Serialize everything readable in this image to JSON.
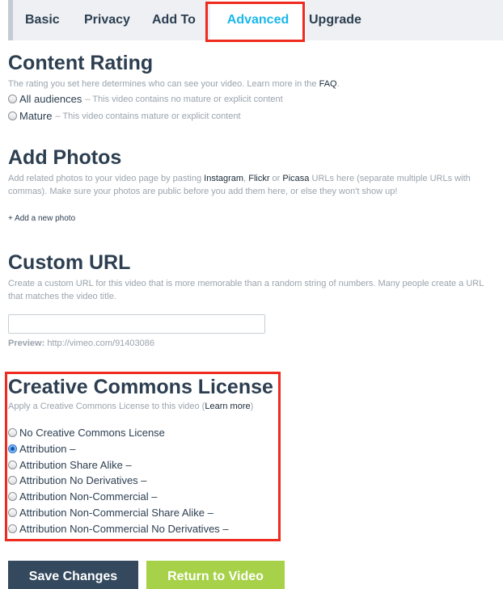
{
  "tabs": [
    {
      "label": "Basic"
    },
    {
      "label": "Privacy"
    },
    {
      "label": "Add To"
    },
    {
      "label": "Advanced"
    },
    {
      "label": "Upgrade"
    }
  ],
  "active_tab": "Advanced",
  "content_rating": {
    "title": "Content Rating",
    "desc_prefix": "The rating you set here determines who can see your video. Learn more in the ",
    "faq_link": "FAQ",
    "desc_suffix": ".",
    "options": [
      {
        "label": "All audiences",
        "sub": "– This video contains no mature or explicit content",
        "checked": false
      },
      {
        "label": "Mature",
        "sub": "– This video contains mature or explicit content",
        "checked": false
      }
    ]
  },
  "add_photos": {
    "title": "Add Photos",
    "desc_p1": "Add related photos to your video page by pasting ",
    "instagram": "Instagram",
    "sep1": ", ",
    "flickr": "Flickr",
    "sep2": " or ",
    "picasa": "Picasa",
    "desc_p2": " URLs here (separate multiple URLs with commas). Make sure your photos are public before you add them here, or else they won't show up!",
    "add_link": "+ Add a new photo"
  },
  "custom_url": {
    "title": "Custom URL",
    "desc": "Create a custom URL for this video that is more memorable than a random string of numbers. Many people create a URL that matches the video title.",
    "input_value": "",
    "preview_label": "Preview:",
    "preview_value": "http://vimeo.com/91403086"
  },
  "creative_commons": {
    "title": "Creative Commons License",
    "desc_prefix": "Apply a Creative Commons License to this video (",
    "learn_more": "Learn more",
    "desc_suffix": ")",
    "options": [
      {
        "label": "No Creative Commons License",
        "checked": false
      },
      {
        "label": "Attribution –",
        "checked": true
      },
      {
        "label": "Attribution Share Alike –",
        "checked": false
      },
      {
        "label": "Attribution No Derivatives –",
        "checked": false
      },
      {
        "label": "Attribution Non-Commercial –",
        "checked": false
      },
      {
        "label": "Attribution Non-Commercial Share Alike –",
        "checked": false
      },
      {
        "label": "Attribution Non-Commercial No Derivatives –",
        "checked": false
      }
    ]
  },
  "buttons": {
    "save": "Save Changes",
    "return": "Return to Video"
  },
  "colors": {
    "accent": "#1ab7ea",
    "highlight": "#ef2a1f",
    "save_bg": "#34495e",
    "return_bg": "#a6d148"
  },
  "icons": {
    "radio_unchecked": "radio-unchecked-icon",
    "radio_checked": "radio-checked-icon"
  }
}
